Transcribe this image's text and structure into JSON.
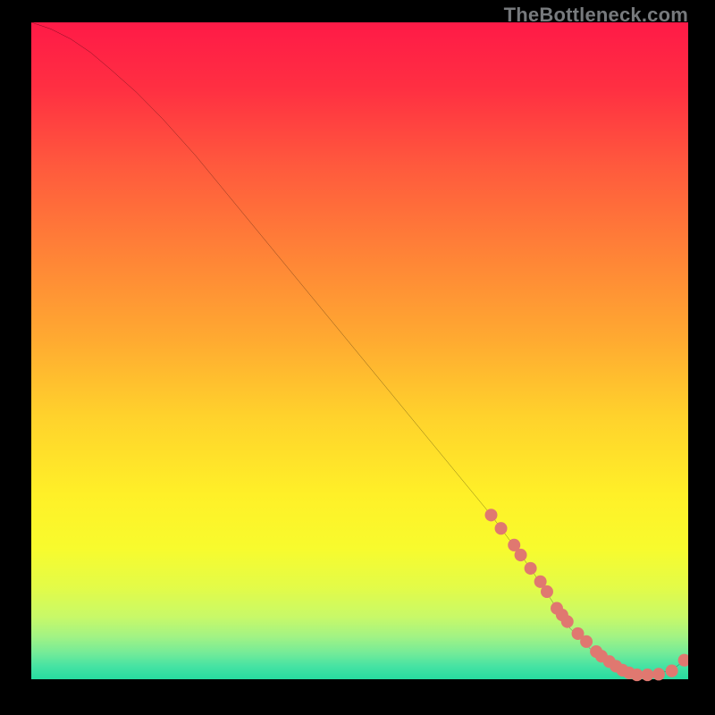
{
  "watermark": "TheBottleneck.com",
  "chart_data": {
    "type": "line",
    "title": "",
    "xlabel": "",
    "ylabel": "",
    "xlim": [
      0,
      100
    ],
    "ylim": [
      0,
      100
    ],
    "series": [
      {
        "name": "curve",
        "x": [
          0,
          3,
          6,
          9,
          12,
          16,
          20,
          25,
          30,
          35,
          40,
          45,
          50,
          55,
          60,
          65,
          70,
          73,
          76,
          78,
          80,
          82,
          84,
          86,
          88,
          90,
          92,
          94,
          96,
          98,
          99,
          100
        ],
        "y": [
          100,
          99,
          97.5,
          95.5,
          93,
          89.5,
          85.5,
          80,
          74,
          68,
          62,
          56,
          50,
          44,
          38,
          32,
          26,
          22,
          18,
          15,
          12,
          9,
          7,
          5,
          3.5,
          2.5,
          2,
          2,
          2.3,
          3.1,
          3.8,
          4.6
        ]
      }
    ],
    "markers": {
      "name": "dots",
      "color": "#e07870",
      "x": [
        70,
        71.5,
        73.5,
        74.5,
        76,
        77.5,
        78.5,
        80,
        80.8,
        81.6,
        83.2,
        84.5,
        86,
        86.8,
        88,
        89,
        90,
        91,
        92.2,
        93.8,
        95.5,
        97.5,
        99.4
      ],
      "y": [
        26,
        24,
        21.5,
        20,
        18,
        16,
        14.5,
        12,
        11,
        10,
        8.2,
        7,
        5.5,
        4.8,
        4,
        3.3,
        2.7,
        2.3,
        2.0,
        2.0,
        2.1,
        2.6,
        4.2
      ]
    },
    "gradient_stops": [
      {
        "offset": 0.0,
        "color": "#ff1a47"
      },
      {
        "offset": 0.1,
        "color": "#ff2f42"
      },
      {
        "offset": 0.22,
        "color": "#ff5a3d"
      },
      {
        "offset": 0.35,
        "color": "#ff8237"
      },
      {
        "offset": 0.48,
        "color": "#ffa931"
      },
      {
        "offset": 0.6,
        "color": "#ffd22c"
      },
      {
        "offset": 0.72,
        "color": "#fff028"
      },
      {
        "offset": 0.8,
        "color": "#f8fb2d"
      },
      {
        "offset": 0.86,
        "color": "#e3fb48"
      },
      {
        "offset": 0.905,
        "color": "#c8f968"
      },
      {
        "offset": 0.935,
        "color": "#a2f384"
      },
      {
        "offset": 0.96,
        "color": "#74eb98"
      },
      {
        "offset": 0.98,
        "color": "#46e3a3"
      },
      {
        "offset": 1.0,
        "color": "#27dca0"
      }
    ]
  }
}
